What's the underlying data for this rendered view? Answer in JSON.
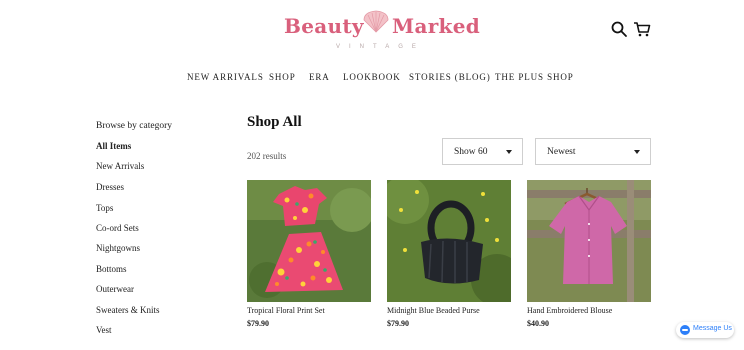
{
  "brand": {
    "word1": "Beauty",
    "word2": "Marked",
    "sub": "VINTAGE"
  },
  "header_icons": [
    "search-icon",
    "cart-icon"
  ],
  "nav": [
    "NEW ARRIVALS",
    "SHOP",
    "ERA",
    "LOOKBOOK",
    "STORIES (BLOG)",
    "THE PLUS SHOP"
  ],
  "sidebar": {
    "heading": "Browse by category",
    "categories": [
      "All Items",
      "New Arrivals",
      "Dresses",
      "Tops",
      "Co-ord Sets",
      "Nightgowns",
      "Bottoms",
      "Outerwear",
      "Sweaters & Knits",
      "Vest"
    ],
    "active": "All Items"
  },
  "main": {
    "title": "Shop All",
    "results": "202 results",
    "show_select": "Show 60",
    "sort_select": "Newest"
  },
  "products": [
    {
      "name": "Tropical Floral Print Set",
      "price": "$79.90"
    },
    {
      "name": "Midnight Blue Beaded Purse",
      "price": "$79.90"
    },
    {
      "name": "Hand Embroidered Blouse",
      "price": "$40.90"
    }
  ],
  "message_chip": {
    "label": "Message Us"
  },
  "colors": {
    "brand_pink": "#d9607c",
    "chat_blue": "#2d7ff9"
  }
}
